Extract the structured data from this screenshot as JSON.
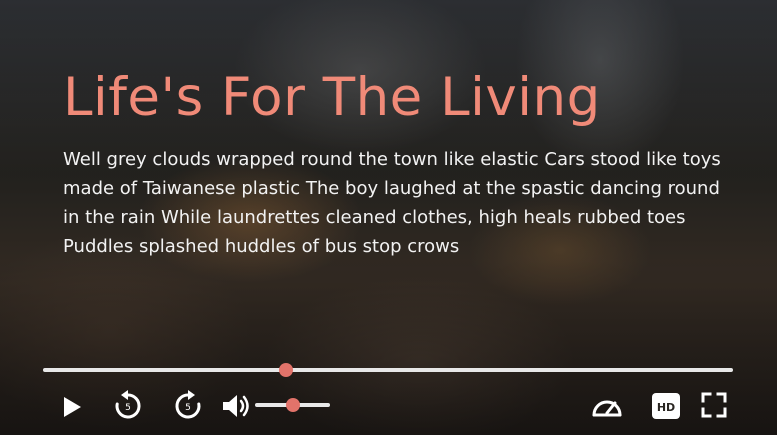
{
  "player": {
    "title": "Life's For The Living",
    "description": "Well grey clouds wrapped round the town like elastic Cars stood like toys made of Taiwanese plastic The boy laughed at the spastic dancing round in the rain While laundrettes cleaned clothes, high heals rubbed toes Puddles splashed huddles of bus stop crows",
    "progress_fraction": 0.352,
    "volume_fraction": 0.5,
    "skip_back_seconds": "5",
    "skip_forward_seconds": "5",
    "quality_badge": "HD",
    "colors": {
      "title": "#f08a78",
      "accent": "#e2736a",
      "track": "#e8e8e8",
      "text": "#f2f2f2"
    },
    "icons": {
      "play": "play-icon",
      "rewind": "rewind-5-icon",
      "forward": "forward-5-icon",
      "volume": "volume-icon",
      "speed": "speedometer-icon",
      "hd": "hd-icon",
      "fullscreen": "fullscreen-icon"
    }
  }
}
